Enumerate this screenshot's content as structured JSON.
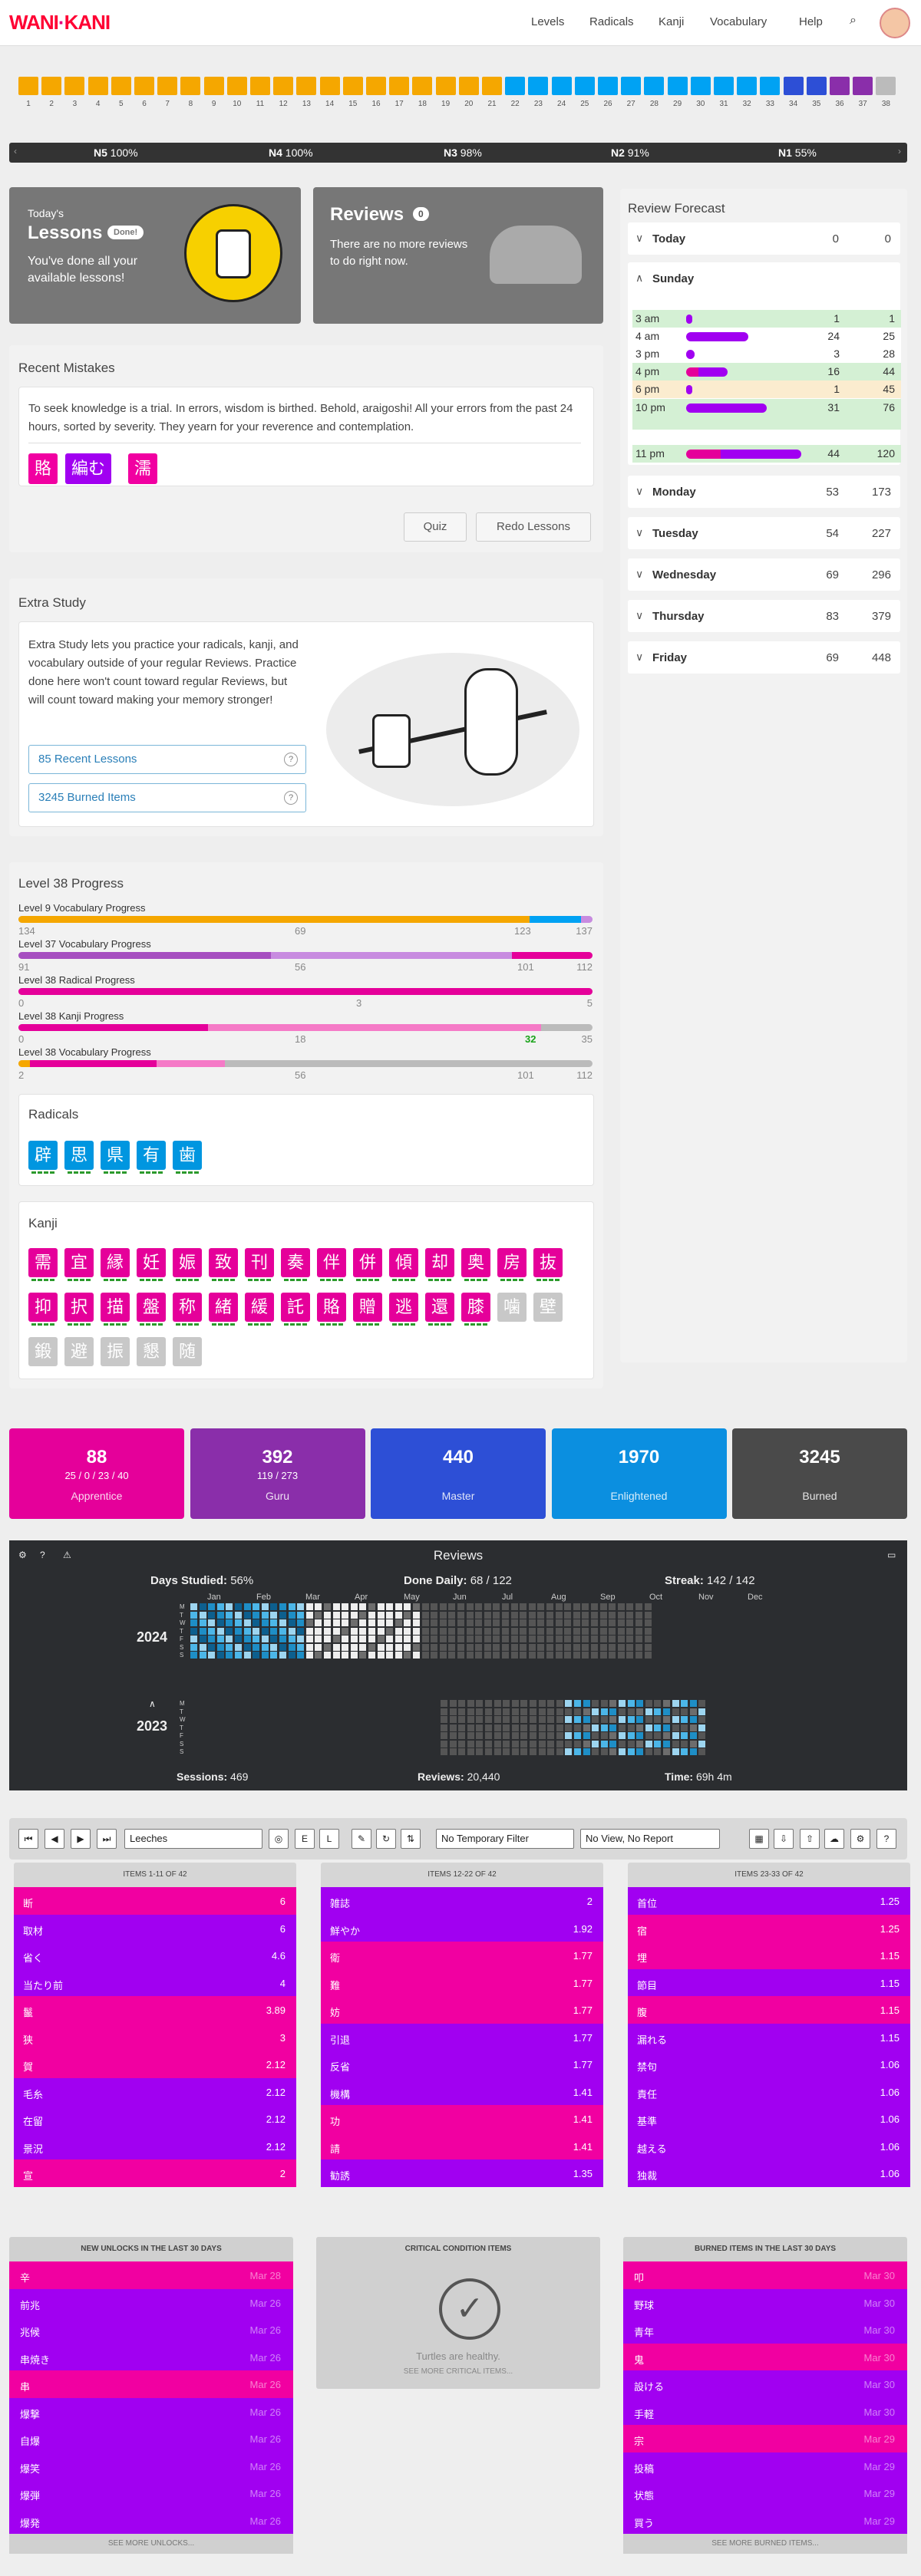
{
  "header": {
    "logo_left": "WANI",
    "logo_right": "KANI",
    "nav": [
      "Levels",
      "Radicals",
      "Kanji",
      "Vocabulary",
      "Help"
    ]
  },
  "levels": {
    "numbers": [
      "1",
      "2",
      "3",
      "4",
      "5",
      "6",
      "7",
      "8",
      "9",
      "10",
      "11",
      "12",
      "13",
      "14",
      "15",
      "16",
      "17",
      "18",
      "19",
      "20",
      "21",
      "22",
      "23",
      "24",
      "25",
      "26",
      "27",
      "28",
      "29",
      "30",
      "31",
      "32",
      "33",
      "34",
      "35",
      "36",
      "37",
      "38"
    ]
  },
  "jlpt": [
    {
      "name": "N5",
      "pct": "100%"
    },
    {
      "name": "N4",
      "pct": "100%"
    },
    {
      "name": "N3",
      "pct": "98%"
    },
    {
      "name": "N2",
      "pct": "91%"
    },
    {
      "name": "N1",
      "pct": "55%"
    }
  ],
  "lessons": {
    "today": "Today's",
    "title": "Lessons",
    "badge": "Done!",
    "text": "You've done all your available lessons!"
  },
  "reviews": {
    "title": "Reviews",
    "count": "0",
    "text": "There are no more reviews to do right now."
  },
  "mistakes": {
    "title": "Recent Mistakes",
    "text": "To seek knowledge is a trial. In errors, wisdom is birthed. Behold, araigoshi! All your errors from the past 24 hours, sorted by severity. They yearn for your reverence and contemplation.",
    "items": [
      "賂",
      "編む",
      "濡"
    ],
    "quiz": "Quiz",
    "redo": "Redo Lessons"
  },
  "extra": {
    "title": "Extra Study",
    "text": "Extra Study lets you practice your radicals, kanji, and vocabulary outside of your regular Reviews. Practice done here won't count toward regular Reviews, but will count toward making your memory stronger!",
    "recent": "85 Recent Lessons",
    "burned": "3245 Burned Items"
  },
  "forecast": {
    "title": "Review Forecast",
    "today": {
      "name": "Today",
      "a": "0",
      "b": "0"
    },
    "sunday": "Sunday",
    "rows": [
      {
        "t": "3 am",
        "n": "1",
        "c": "1",
        "w": 0.02
      },
      {
        "t": "4 am",
        "n": "24",
        "c": "25",
        "w": 0.54
      },
      {
        "t": "3 pm",
        "n": "3",
        "c": "28",
        "w": 0.07
      },
      {
        "t": "4 pm",
        "n": "16",
        "c": "44",
        "w": 0.36
      },
      {
        "t": "6 pm",
        "n": "1",
        "c": "45",
        "w": 0.02
      },
      {
        "t": "10 pm",
        "n": "31",
        "c": "76",
        "w": 0.7
      },
      {
        "t": "11 pm",
        "n": "44",
        "c": "120",
        "w": 1.0
      }
    ],
    "days": [
      {
        "name": "Monday",
        "a": "53",
        "b": "173"
      },
      {
        "name": "Tuesday",
        "a": "54",
        "b": "227"
      },
      {
        "name": "Wednesday",
        "a": "69",
        "b": "296"
      },
      {
        "name": "Thursday",
        "a": "83",
        "b": "379"
      },
      {
        "name": "Friday",
        "a": "69",
        "b": "448"
      }
    ]
  },
  "progress": {
    "title": "Level 38 Progress",
    "rows": [
      {
        "label": "Level 9 Vocabulary Progress",
        "left": "134",
        "mid": "69",
        "mid2": "123",
        "right": "137"
      },
      {
        "label": "Level 37 Vocabulary Progress",
        "left": "91",
        "mid": "56",
        "mid2": "101",
        "right": "112"
      },
      {
        "label": "Level 38 Radical Progress",
        "left": "0",
        "mid": "3",
        "mid2": "",
        "right": "5"
      },
      {
        "label": "Level 38 Kanji Progress",
        "left": "0",
        "mid": "18",
        "mid2": "32",
        "right": "35"
      },
      {
        "label": "Level 38 Vocabulary Progress",
        "left": "2",
        "mid": "56",
        "mid2": "101",
        "right": "112"
      }
    ]
  },
  "radicals": {
    "title": "Radicals",
    "items": [
      "辟",
      "思",
      "県",
      "有",
      "歯"
    ]
  },
  "kanji": {
    "title": "Kanji",
    "items": [
      "需",
      "宜",
      "縁",
      "妊",
      "娠",
      "致",
      "刊",
      "奏",
      "伴",
      "併",
      "傾",
      "却",
      "奥",
      "房",
      "抜",
      "抑",
      "択",
      "描",
      "盤",
      "称",
      "緒",
      "緩",
      "託",
      "賂",
      "贈",
      "逃",
      "還",
      "膝",
      "噛",
      "壁",
      "鍛",
      "避",
      "振",
      "懇",
      "随"
    ]
  },
  "srs": [
    {
      "num": "88",
      "sub": "25 / 0 / 23 / 40",
      "name": "Apprentice",
      "color": "#e5009a"
    },
    {
      "num": "392",
      "sub": "119 / 273",
      "name": "Guru",
      "color": "#8a2eaa"
    },
    {
      "num": "440",
      "sub": "",
      "name": "Master",
      "color": "#2d4fd6"
    },
    {
      "num": "1970",
      "sub": "",
      "name": "Enlightened",
      "color": "#0b8fe0"
    },
    {
      "num": "3245",
      "sub": "",
      "name": "Burned",
      "color": "#4a4a4a"
    }
  ],
  "heatmap": {
    "title": "Reviews",
    "days": "Days Studied:",
    "days_v": "56%",
    "done": "Done Daily:",
    "done_v": "68 / 122",
    "streak": "Streak:",
    "streak_v": "142 / 142",
    "y1": "2024",
    "y2": "2023",
    "months": [
      "Jan",
      "Feb",
      "Mar",
      "Apr",
      "May",
      "Jun",
      "Jul",
      "Aug",
      "Sep",
      "Oct",
      "Nov",
      "Dec"
    ],
    "sessions": "Sessions:",
    "sessions_v": "469",
    "reviews": "Reviews:",
    "reviews_v": "20,440",
    "time": "Time:",
    "time_v": "69h 4m"
  },
  "leech": {
    "filter": "Leeches",
    "temp": "No Temporary Filter",
    "view": "No View, No Report",
    "cols": [
      {
        "head": "ITEMS 1-11 OF 42",
        "rows": [
          [
            "断",
            "6",
            "pink"
          ],
          [
            "取材",
            "6",
            "purp"
          ],
          [
            "省く",
            "4.6",
            "purp"
          ],
          [
            "当たり前",
            "4",
            "purp"
          ],
          [
            "鬣",
            "3.89",
            "pink"
          ],
          [
            "狭",
            "3",
            "pink"
          ],
          [
            "賀",
            "2.12",
            "pink"
          ],
          [
            "毛糸",
            "2.12",
            "purp"
          ],
          [
            "在留",
            "2.12",
            "purp"
          ],
          [
            "景況",
            "2.12",
            "purp"
          ],
          [
            "宣",
            "2",
            "pink"
          ]
        ]
      },
      {
        "head": "ITEMS 12-22 OF 42",
        "rows": [
          [
            "雑誌",
            "2",
            "purp"
          ],
          [
            "鮮やか",
            "1.92",
            "purp"
          ],
          [
            "衛",
            "1.77",
            "pink"
          ],
          [
            "難",
            "1.77",
            "pink"
          ],
          [
            "妨",
            "1.77",
            "pink"
          ],
          [
            "引退",
            "1.77",
            "purp"
          ],
          [
            "反省",
            "1.77",
            "purp"
          ],
          [
            "機構",
            "1.41",
            "purp"
          ],
          [
            "功",
            "1.41",
            "pink"
          ],
          [
            "請",
            "1.41",
            "pink"
          ],
          [
            "勧誘",
            "1.35",
            "purp"
          ]
        ]
      },
      {
        "head": "ITEMS 23-33 OF 42",
        "rows": [
          [
            "首位",
            "1.25",
            "purp"
          ],
          [
            "宿",
            "1.25",
            "pink"
          ],
          [
            "埋",
            "1.15",
            "pink"
          ],
          [
            "節目",
            "1.15",
            "purp"
          ],
          [
            "腹",
            "1.15",
            "pink"
          ],
          [
            "漏れる",
            "1.15",
            "purp"
          ],
          [
            "禁句",
            "1.06",
            "purp"
          ],
          [
            "責任",
            "1.06",
            "purp"
          ],
          [
            "基準",
            "1.06",
            "purp"
          ],
          [
            "越える",
            "1.06",
            "purp"
          ],
          [
            "独裁",
            "1.06",
            "purp"
          ]
        ]
      }
    ]
  },
  "unlocks": {
    "head": "NEW UNLOCKS IN THE LAST 30 DAYS",
    "foot": "SEE MORE UNLOCKS...",
    "rows": [
      [
        "辛",
        "Mar 28",
        "pink"
      ],
      [
        "前兆",
        "Mar 26",
        "purp"
      ],
      [
        "兆候",
        "Mar 26",
        "purp"
      ],
      [
        "串焼き",
        "Mar 26",
        "purp"
      ],
      [
        "串",
        "Mar 26",
        "pink"
      ],
      [
        "爆撃",
        "Mar 26",
        "purp"
      ],
      [
        "自爆",
        "Mar 26",
        "purp"
      ],
      [
        "爆笑",
        "Mar 26",
        "purp"
      ],
      [
        "爆弾",
        "Mar 26",
        "purp"
      ],
      [
        "爆発",
        "Mar 26",
        "purp"
      ]
    ]
  },
  "critical": {
    "head": "CRITICAL CONDITION ITEMS",
    "text": "Turtles are healthy.",
    "foot": "SEE MORE CRITICAL ITEMS..."
  },
  "burned": {
    "head": "BURNED ITEMS IN THE LAST 30 DAYS",
    "foot": "SEE MORE BURNED ITEMS...",
    "rows": [
      [
        "叩",
        "Mar 30",
        "pink"
      ],
      [
        "野球",
        "Mar 30",
        "purp"
      ],
      [
        "青年",
        "Mar 30",
        "purp"
      ],
      [
        "鬼",
        "Mar 30",
        "pink"
      ],
      [
        "設ける",
        "Mar 30",
        "purp"
      ],
      [
        "手軽",
        "Mar 30",
        "purp"
      ],
      [
        "宗",
        "Mar 29",
        "pink"
      ],
      [
        "投稿",
        "Mar 29",
        "purp"
      ],
      [
        "状態",
        "Mar 29",
        "purp"
      ],
      [
        "買う",
        "Mar 29",
        "purp"
      ]
    ]
  }
}
